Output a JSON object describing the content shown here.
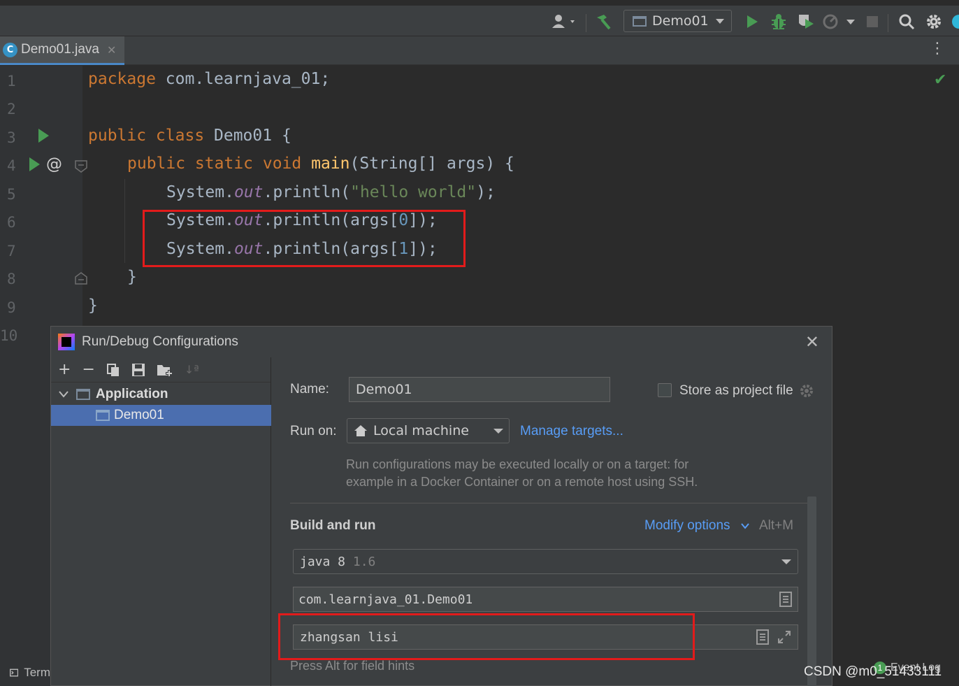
{
  "toolbar": {
    "run_config": "Demo01"
  },
  "tab": {
    "filename": "Demo01.java",
    "icon_letter": "C"
  },
  "editor": {
    "line_numbers": [
      "1",
      "2",
      "3",
      "4",
      "5",
      "6",
      "7",
      "8",
      "9",
      "10"
    ],
    "lines": {
      "l1_kw": "package",
      "l1_rest": " com.learnjava_01;",
      "l3_kw": "public class",
      "l3_rest": " Demo01 {",
      "l4_kw": "public static void",
      "l4_fn": "main",
      "l4_rest": "(String[] args) {",
      "l5_a": "System.",
      "l5_fld": "out",
      "l5_b": ".println(",
      "l5_str": "\"hello world\"",
      "l5_c": ");",
      "l6_a": "System.",
      "l6_fld": "out",
      "l6_b": ".println(args[",
      "l6_num": "0",
      "l6_c": "]);",
      "l7_a": "System.",
      "l7_fld": "out",
      "l7_b": ".println(args[",
      "l7_num": "1",
      "l7_c": "]);",
      "l8": "}",
      "l9": "}"
    },
    "gutter_at": "@"
  },
  "dialog": {
    "title": "Run/Debug Configurations",
    "tree": {
      "group": "Application",
      "item": "Demo01"
    },
    "name_label": "Name:",
    "name_value": "Demo01",
    "store_label": "Store as project file",
    "run_on_label": "Run on:",
    "run_on_value": "Local machine",
    "manage_targets": "Manage targets...",
    "run_hint_1": "Run configurations may be executed locally or on a target: for",
    "run_hint_2": "example in a Docker Container or on a remote host using SSH.",
    "build_and_run": "Build and run",
    "modify_options": "Modify options",
    "modify_shortcut": "Alt+M",
    "jdk_name": "java 8",
    "jdk_version": "1.6",
    "main_class": "com.learnjava_01.Demo01",
    "program_args": "zhangsan lisi",
    "field_hint": "Press Alt for field hints"
  },
  "bottom": {
    "terminal_label": "Term",
    "event_log": "Event Log",
    "event_count": "1",
    "watermark": "CSDN @m0_51433111"
  },
  "colors": {
    "keyword": "#cc7832",
    "string": "#6a8759",
    "number": "#6897bb",
    "field": "#9876aa",
    "function": "#ffc66d",
    "highlight_box": "#e21b1b",
    "link": "#589df6",
    "selection": "#4b6eaf"
  }
}
